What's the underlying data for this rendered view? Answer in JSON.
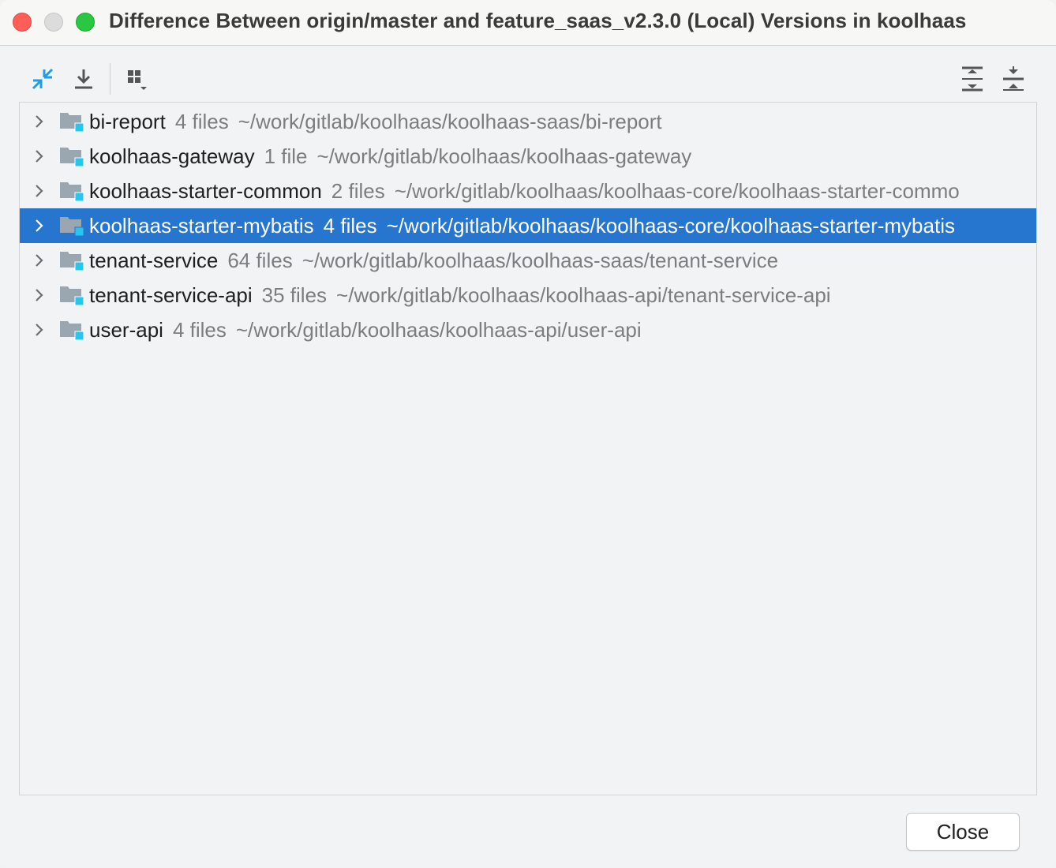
{
  "window": {
    "title": "Difference Between origin/master and feature_saas_v2.3.0 (Local) Versions in koolhaas"
  },
  "toolbar": {
    "left_buttons": [
      "compare-arrows-icon",
      "download-icon",
      "group-by-icon"
    ],
    "right_buttons": [
      "expand-all-icon",
      "collapse-all-icon"
    ],
    "accent_color": "#1e9ee6"
  },
  "tree": {
    "selected_color": "#2675cf",
    "items": [
      {
        "name": "bi-report",
        "count": "4 files",
        "path": "~/work/gitlab/koolhaas/koolhaas-saas/bi-report",
        "selected": false
      },
      {
        "name": "koolhaas-gateway",
        "count": "1 file",
        "path": "~/work/gitlab/koolhaas/koolhaas-gateway",
        "selected": false
      },
      {
        "name": "koolhaas-starter-common",
        "count": "2 files",
        "path": "~/work/gitlab/koolhaas/koolhaas-core/koolhaas-starter-commo",
        "selected": false
      },
      {
        "name": "koolhaas-starter-mybatis",
        "count": "4 files",
        "path": "~/work/gitlab/koolhaas/koolhaas-core/koolhaas-starter-mybatis",
        "selected": true
      },
      {
        "name": "tenant-service",
        "count": "64 files",
        "path": "~/work/gitlab/koolhaas/koolhaas-saas/tenant-service",
        "selected": false
      },
      {
        "name": "tenant-service-api",
        "count": "35 files",
        "path": "~/work/gitlab/koolhaas/koolhaas-api/tenant-service-api",
        "selected": false
      },
      {
        "name": "user-api",
        "count": "4 files",
        "path": "~/work/gitlab/koolhaas/koolhaas-api/user-api",
        "selected": false
      }
    ]
  },
  "footer": {
    "close_label": "Close"
  }
}
